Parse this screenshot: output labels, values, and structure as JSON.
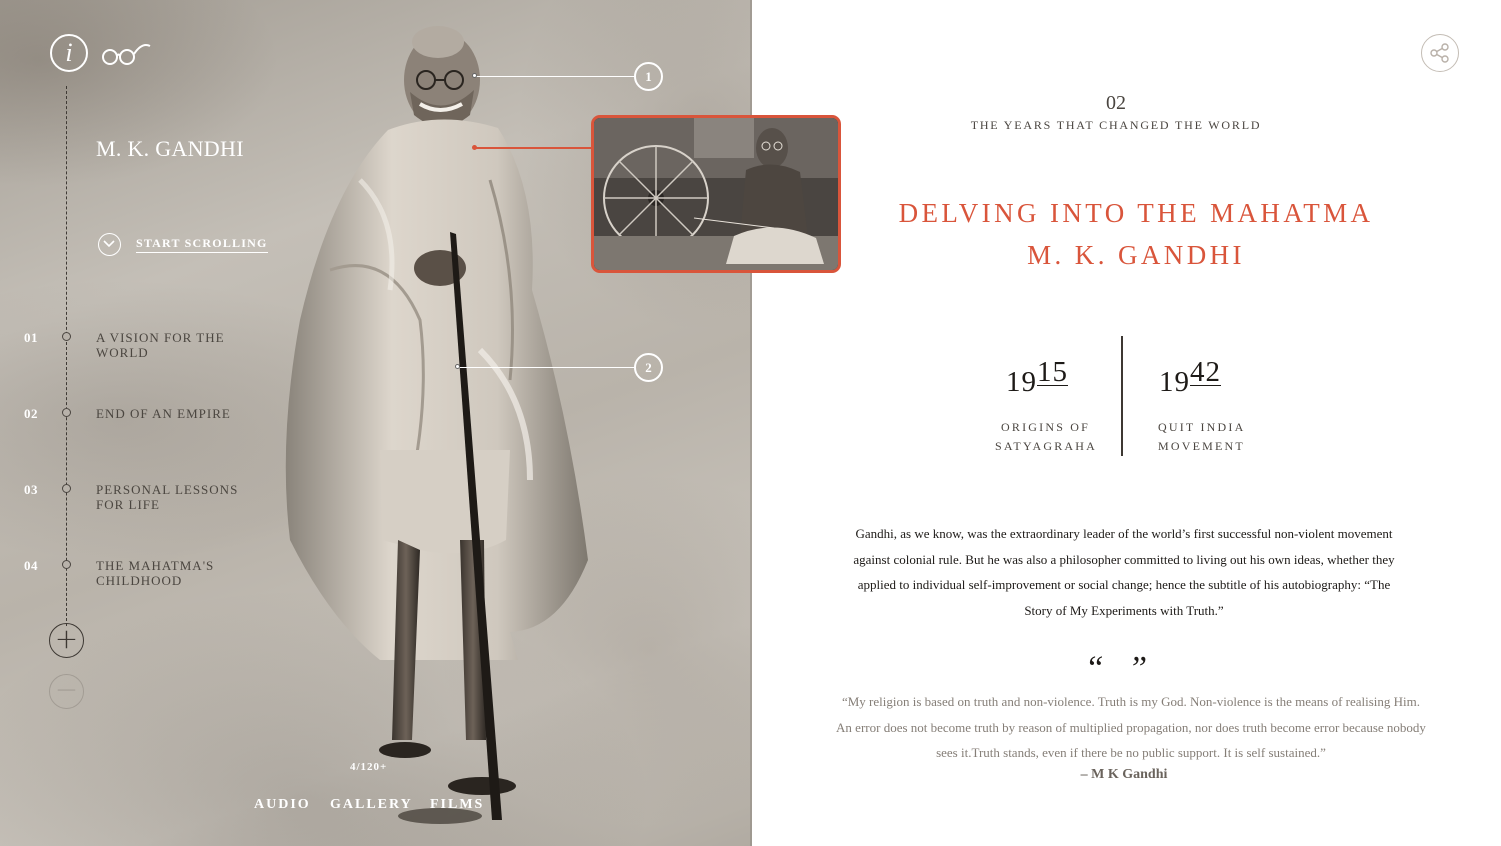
{
  "brand": {
    "title": "M. K. GANDHI",
    "info_glyph": "i",
    "start_scrolling": "START SCROLLING"
  },
  "chapters": [
    {
      "num": "01",
      "label": "A VISION FOR THE WORLD"
    },
    {
      "num": "02",
      "label": "END OF AN EMPIRE"
    },
    {
      "num": "03",
      "label": "PERSONAL LESSONS FOR LIFE"
    },
    {
      "num": "04",
      "label": "THE MAHATMA'S CHILDHOOD"
    }
  ],
  "zoom": {
    "in": "+",
    "out": "−"
  },
  "hotspots": [
    "1",
    "2"
  ],
  "media": {
    "counter": "4/120+",
    "tabs": [
      "AUDIO",
      "GALLERY",
      "FILMS"
    ]
  },
  "section": {
    "number": "02",
    "subtitle": "THE YEARS THAT CHANGED THE WORLD",
    "headline_line1": "DELVING INTO THE MAHATMA",
    "headline_line2": "M. K. GANDHI"
  },
  "milestones": [
    {
      "year_prefix": "19",
      "year_suffix": "15",
      "label_line1": "ORIGINS OF",
      "label_line2": "SATYAGRAHA"
    },
    {
      "year_prefix": "19",
      "year_suffix": "42",
      "label_line1": "QUIT INDIA",
      "label_line2": "MOVEMENT"
    }
  ],
  "body": "Gandhi, as we know, was the extraordinary leader of the world’s first successful non-violent movement against colonial rule. But he was also a philosopher committed to living out his own ideas, whether they applied to individual self-improvement or social change; hence the subtitle of his autobiography: “The Story of My Experiments with Truth.”",
  "quote": {
    "marks": "“ ”",
    "text": "“My religion is based on truth and non-violence. Truth is my God. Non-violence is the means of realising Him. An error does not become truth by reason of multiplied propagation, nor does truth become error because nobody sees it.Truth stands, even if there be no public support. It is self sustained.”",
    "author": "– M K Gandhi"
  },
  "colors": {
    "accent": "#d9553b",
    "text_dark": "#1d1a17",
    "text_muted": "#857e77"
  },
  "icons": [
    "info-icon",
    "glasses-icon",
    "chevron-down-icon",
    "plus-icon",
    "minus-icon",
    "share-icon"
  ]
}
